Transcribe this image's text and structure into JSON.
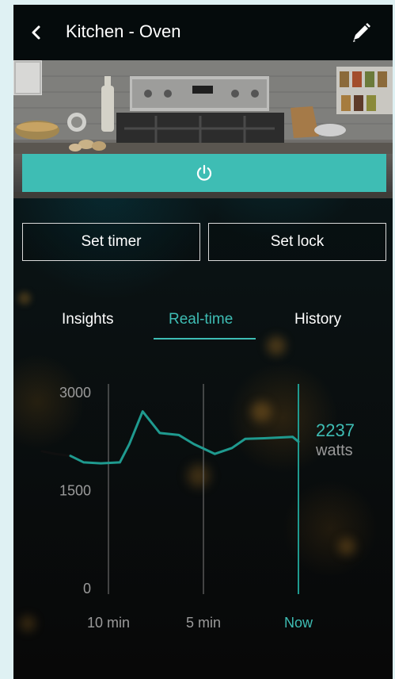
{
  "header": {
    "title": "Kitchen - Oven",
    "back_icon": "chevron-left-icon",
    "edit_icon": "pencil-icon"
  },
  "hero": {
    "power_icon": "power-icon",
    "accent_color": "#3ebdb4"
  },
  "actions": {
    "set_timer": "Set timer",
    "set_lock": "Set lock"
  },
  "tabs": [
    {
      "label": "Insights",
      "active": false
    },
    {
      "label": "Real-time",
      "active": true
    },
    {
      "label": "History",
      "active": false
    }
  ],
  "chart_data": {
    "type": "line",
    "title": "",
    "xlabel": "",
    "ylabel": "",
    "y_ticks": [
      "3000",
      "1500",
      "0"
    ],
    "ylim": [
      0,
      3000
    ],
    "x_ticks": [
      "10 min",
      "5 min",
      "Now"
    ],
    "current_value": "2237",
    "current_unit": "watts",
    "series": [
      {
        "color": "#1f9a8f",
        "x": [
          -13.5,
          -12.8,
          -12,
          -11.3,
          -10.4,
          -9.4,
          -8.9,
          -8.2,
          -7.3,
          -6.3,
          -5.5,
          -4.4,
          -3.5,
          -2.8,
          -1.8,
          -0.3,
          0
        ],
        "y": [
          2090,
          2050,
          2020,
          1920,
          1905,
          1920,
          2200,
          2700,
          2370,
          2340,
          2200,
          2050,
          2140,
          2280,
          2290,
          2310,
          2237
        ]
      }
    ],
    "colors": {
      "line": "#1f9a8f",
      "accent": "#3ebdb4",
      "axis": "#9a9a9a"
    }
  }
}
